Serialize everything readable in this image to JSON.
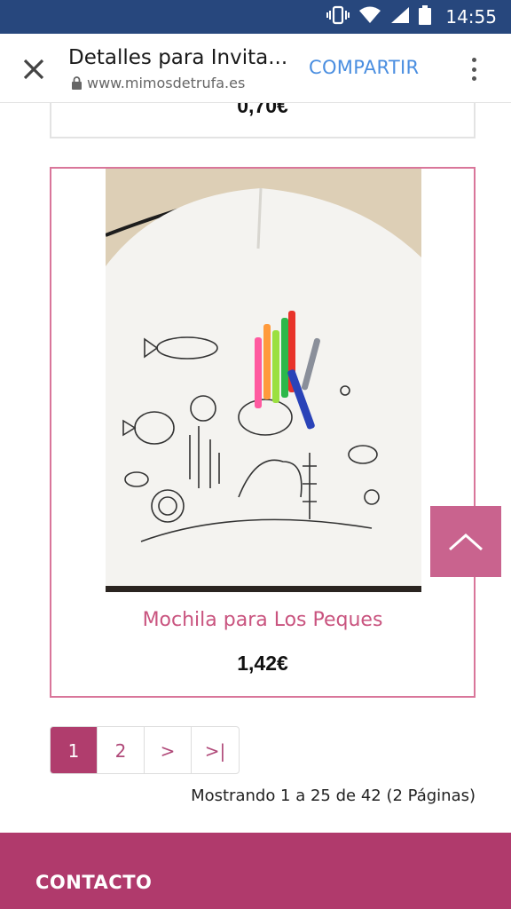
{
  "status_bar": {
    "time": "14:55"
  },
  "browser": {
    "tab_title": "Detalles para Invita...",
    "url": "www.mimosdetrufa.es",
    "share_label": "COMPARTIR"
  },
  "previous_product": {
    "price": "0,70€"
  },
  "product": {
    "name": "Mochila para Los Peques",
    "price": "1,42€"
  },
  "pagination": {
    "pages": [
      "1",
      "2",
      ">",
      ">|"
    ],
    "active": "1",
    "results_text": "Mostrando 1 a 25 de 42 (2 Páginas)"
  },
  "footer": {
    "title": "CONTACTO"
  },
  "colors": {
    "brand": "#b03a6c",
    "accent": "#c9547f",
    "status_bar": "#27477d",
    "share": "#4a8ee0"
  }
}
